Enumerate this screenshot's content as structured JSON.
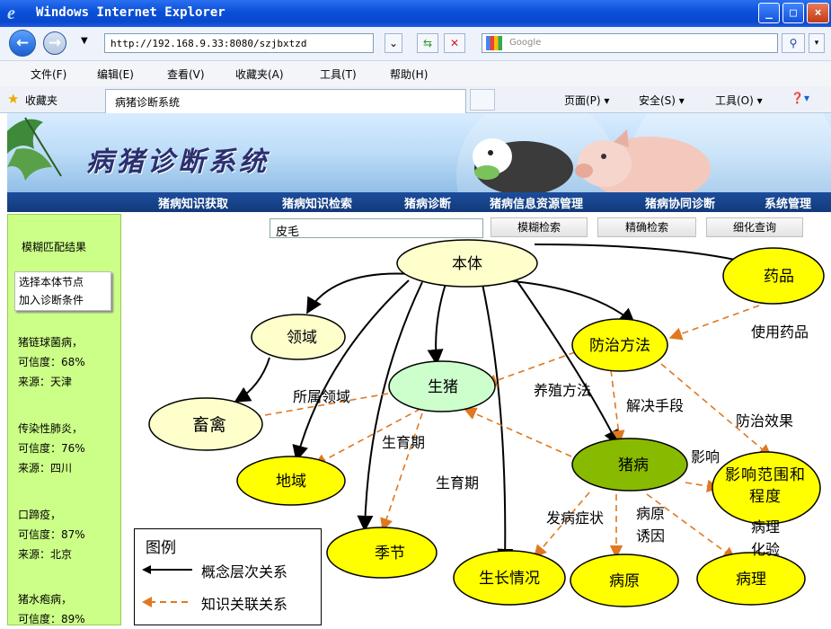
{
  "window": {
    "title": "Windows Internet Explorer",
    "controls": [
      "_",
      "□",
      "×"
    ]
  },
  "addressbar": {
    "url": "http://192.168.9.33:8080/szjbxtzd",
    "search_placeholder": "Google"
  },
  "menu": [
    "文件(F)",
    "编辑(E)",
    "查看(V)",
    "收藏夹(A)",
    "工具(T)",
    "帮助(H)"
  ],
  "favbar": {
    "favorites_label": "收藏夹",
    "tab_title": "病猪诊断系统",
    "right_items": [
      "页面(P) ▾",
      "安全(S) ▾",
      "工具(O) ▾",
      "❓▾"
    ]
  },
  "banner": {
    "title": "病猪诊断系统",
    "nav": [
      "猪病知识获取",
      "猪病知识检索",
      "猪病诊断",
      "猪病信息资源管理",
      "猪病协同诊断",
      "系统管理"
    ]
  },
  "search": {
    "value": "皮毛",
    "buttons": [
      "模糊检索",
      "精确检索",
      "细化查询"
    ]
  },
  "left_panel": {
    "heading": "模糊匹配结果",
    "hint_line1": "选择本体节点",
    "hint_line2": "加入诊断条件",
    "results": [
      {
        "name": "猪链球菌病，",
        "confidence": "可信度：68%",
        "source": "来源：天津"
      },
      {
        "name": "传染性肺炎，",
        "confidence": "可信度：76%",
        "source": "来源：四川"
      },
      {
        "name": "口蹄疫，",
        "confidence": "可信度：87%",
        "source": "来源：北京"
      },
      {
        "name": "猪水疱病，",
        "confidence": "可信度：89%",
        "source": ""
      }
    ]
  },
  "diagram": {
    "nodes": {
      "root": "本体",
      "drug": "药品",
      "domain": "领域",
      "prevention": "防治方法",
      "pig": "生猪",
      "livestock": "畜禽",
      "region": "地域",
      "disease": "猪病",
      "influence": "影响范围和程度",
      "season": "季节",
      "growth": "生长情况",
      "pathogen": "病原",
      "pathology": "病理"
    },
    "edge_labels": {
      "use_drug": "使用药品",
      "belongs_domain": "所属领域",
      "breeding": "养殖方法",
      "solve": "解决手段",
      "effect": "防治效果",
      "growth_period1": "生育期",
      "growth_period2": "生育期",
      "influence": "影响",
      "symptom": "发病症状",
      "cause_line1": "病原",
      "cause_line2": "诱因",
      "test_line1": "病理",
      "test_line2": "化验"
    },
    "colors": {
      "yellow": "#ffff00",
      "cream": "#ffffcc",
      "light_green": "#ccffcc",
      "dark_green": "#88bb00",
      "dash": "#e07820"
    }
  },
  "legend": {
    "title": "图例",
    "concept": "概念层次关系",
    "knowledge": "知识关联关系"
  }
}
